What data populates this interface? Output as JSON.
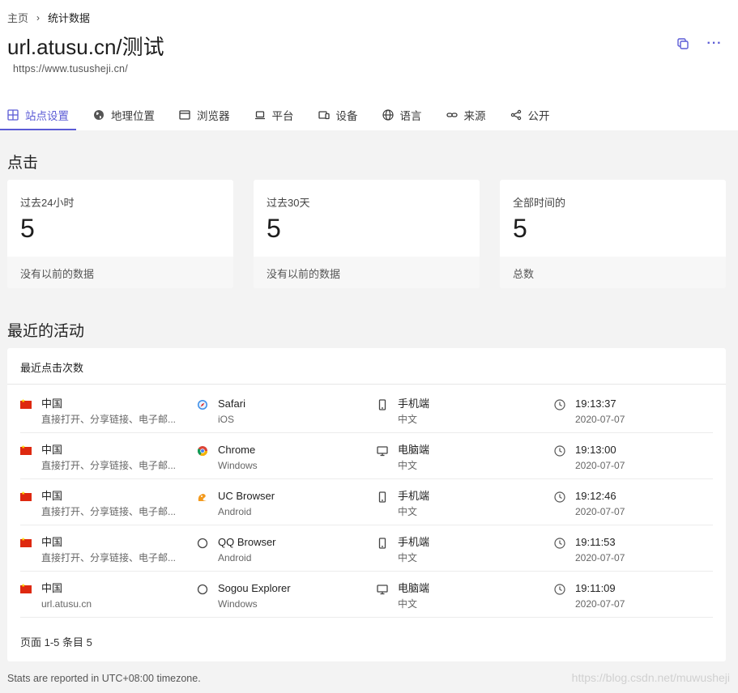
{
  "breadcrumb": {
    "home": "主页",
    "separator": "›",
    "current": "统计数据"
  },
  "site": {
    "title": "url.atusu.cn/测试",
    "url": "https://www.tususheji.cn/"
  },
  "header_actions": {
    "more": "···"
  },
  "tabs": [
    {
      "label": "站点设置",
      "icon": "grid-icon"
    },
    {
      "label": "地理位置",
      "icon": "globe-solid-icon"
    },
    {
      "label": "浏览器",
      "icon": "browser-window-icon"
    },
    {
      "label": "平台",
      "icon": "laptop-icon"
    },
    {
      "label": "设备",
      "icon": "devices-icon"
    },
    {
      "label": "语言",
      "icon": "globe-icon"
    },
    {
      "label": "来源",
      "icon": "link-icon"
    },
    {
      "label": "公开",
      "icon": "share-icon"
    }
  ],
  "clicks": {
    "title": "点击",
    "cards": [
      {
        "label": "过去24小时",
        "value": "5",
        "footer": "没有以前的数据"
      },
      {
        "label": "过去30天",
        "value": "5",
        "footer": "没有以前的数据"
      },
      {
        "label": "全部时间的",
        "value": "5",
        "footer": "总数"
      }
    ]
  },
  "activity": {
    "title": "最近的活动",
    "panel_title": "最近点击次数",
    "rows": [
      {
        "country": "中国",
        "source": "直接打开、分享链接、电子邮...",
        "browser": "Safari",
        "os": "iOS",
        "browser_icon": "safari-icon",
        "device": "手机端",
        "device_icon": "mobile-icon",
        "lang": "中文",
        "time": "19:13:37",
        "date": "2020-07-07"
      },
      {
        "country": "中国",
        "source": "直接打开、分享链接、电子邮...",
        "browser": "Chrome",
        "os": "Windows",
        "browser_icon": "chrome-icon",
        "device": "电脑端",
        "device_icon": "desktop-icon",
        "lang": "中文",
        "time": "19:13:00",
        "date": "2020-07-07"
      },
      {
        "country": "中国",
        "source": "直接打开、分享链接、电子邮...",
        "browser": "UC Browser",
        "os": "Android",
        "browser_icon": "uc-browser-icon",
        "device": "手机端",
        "device_icon": "mobile-icon",
        "lang": "中文",
        "time": "19:12:46",
        "date": "2020-07-07"
      },
      {
        "country": "中国",
        "source": "直接打开、分享链接、电子邮...",
        "browser": "QQ Browser",
        "os": "Android",
        "browser_icon": "circle-icon",
        "device": "手机端",
        "device_icon": "mobile-icon",
        "lang": "中文",
        "time": "19:11:53",
        "date": "2020-07-07"
      },
      {
        "country": "中国",
        "source": "url.atusu.cn",
        "browser": "Sogou Explorer",
        "os": "Windows",
        "browser_icon": "circle-icon",
        "device": "电脑端",
        "device_icon": "desktop-icon",
        "lang": "中文",
        "time": "19:11:09",
        "date": "2020-07-07"
      }
    ],
    "pager": "页面 1-5 条目 5"
  },
  "footer": "Stats are reported in UTC+08:00 timezone.",
  "watermark": "https://blog.csdn.net/muwusheji",
  "colors": {
    "accent": "#5b5bd6",
    "background": "#f3f3f3"
  }
}
